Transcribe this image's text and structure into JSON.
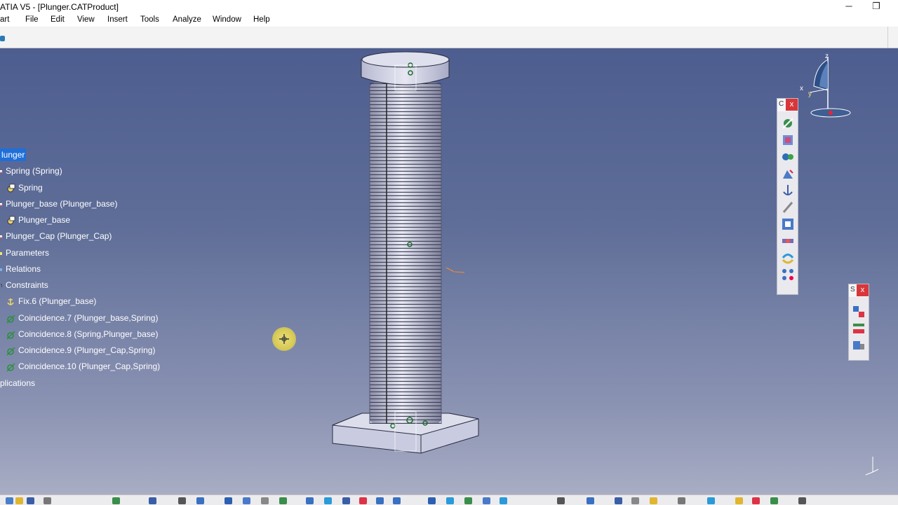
{
  "window": {
    "title": "ATIA V5 - [Plunger.CATProduct]",
    "minimize_glyph": "─",
    "restore_glyph": "❐"
  },
  "menu": {
    "items": [
      "art",
      "File",
      "Edit",
      "View",
      "Insert",
      "Tools",
      "Analyze",
      "Window",
      "Help"
    ]
  },
  "tree": {
    "root": "lunger",
    "items": [
      {
        "label": "Spring (Spring)",
        "icon": "product-icon"
      },
      {
        "label": "Spring",
        "icon": "part-gear-icon"
      },
      {
        "label": "Plunger_base (Plunger_base)",
        "icon": "product-icon"
      },
      {
        "label": "Plunger_base",
        "icon": "part-gear-icon"
      },
      {
        "label": "Plunger_Cap (Plunger_Cap)",
        "icon": "product-icon"
      },
      {
        "label": "Parameters",
        "icon": "parameters-icon"
      },
      {
        "label": "Relations",
        "icon": "relations-icon"
      },
      {
        "label": "Constraints",
        "icon": "constraints-icon"
      },
      {
        "label": "Fix.6 (Plunger_base)",
        "icon": "anchor-icon"
      },
      {
        "label": "Coincidence.7 (Plunger_base,Spring)",
        "icon": "coincidence-icon"
      },
      {
        "label": "Coincidence.8 (Spring,Plunger_base)",
        "icon": "coincidence-icon"
      },
      {
        "label": "Coincidence.9 (Plunger_Cap,Spring)",
        "icon": "coincidence-icon"
      },
      {
        "label": "Coincidence.10 (Plunger_Cap,Spring)",
        "icon": "coincidence-icon"
      },
      {
        "label": "plications",
        "icon": "applications-icon"
      }
    ]
  },
  "compass": {
    "x_label": "x",
    "y_label": "y",
    "z_label": "z"
  },
  "constraints_toolbar": {
    "header": "C",
    "close": "x",
    "tools": [
      "coincidence-constraint-icon",
      "contact-constraint-icon",
      "offset-constraint-icon",
      "angle-constraint-icon",
      "fix-component-icon",
      "fix-together-icon",
      "quick-constraint-icon",
      "flexible-subassembly-icon",
      "change-constraint-icon",
      "reuse-pattern-icon"
    ]
  },
  "space_toolbar": {
    "header": "S",
    "close": "x",
    "tools": [
      "manipulation-icon",
      "snap-icon",
      "explode-icon"
    ]
  },
  "colors": {
    "viewport_top": "#4d5d8f",
    "viewport_bottom": "#a8adc4",
    "selection": "#1e6fd9",
    "part_fill": "#c9cbe0"
  }
}
